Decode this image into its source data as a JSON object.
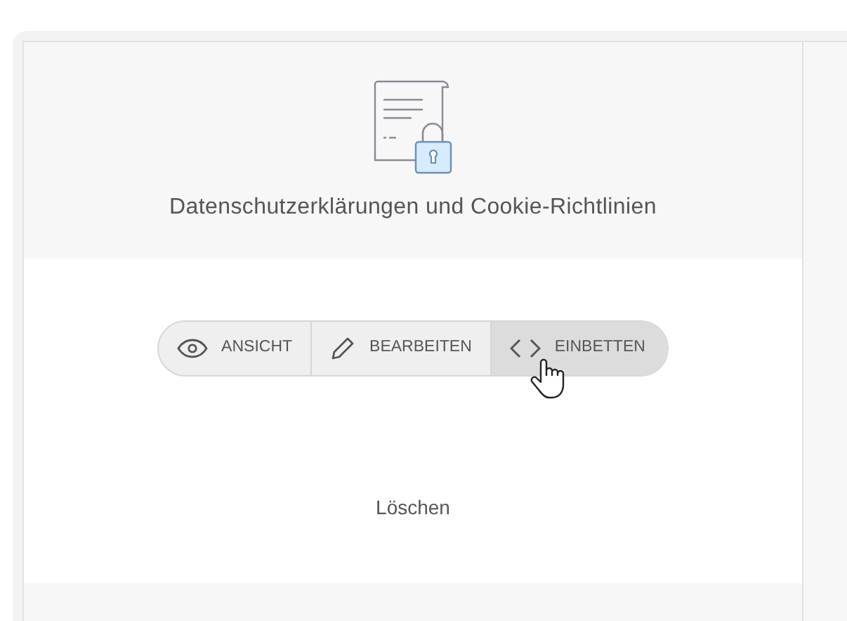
{
  "card": {
    "title": "Datenschutzerklärungen und Cookie-Richtlinien",
    "actions": [
      {
        "kind": "view",
        "label": "ANSICHT",
        "hovered": false
      },
      {
        "kind": "edit",
        "label": "BEARBEITEN",
        "hovered": false
      },
      {
        "kind": "embed",
        "label": "EINBETTEN",
        "hovered": true
      }
    ],
    "delete_link": "Löschen"
  }
}
